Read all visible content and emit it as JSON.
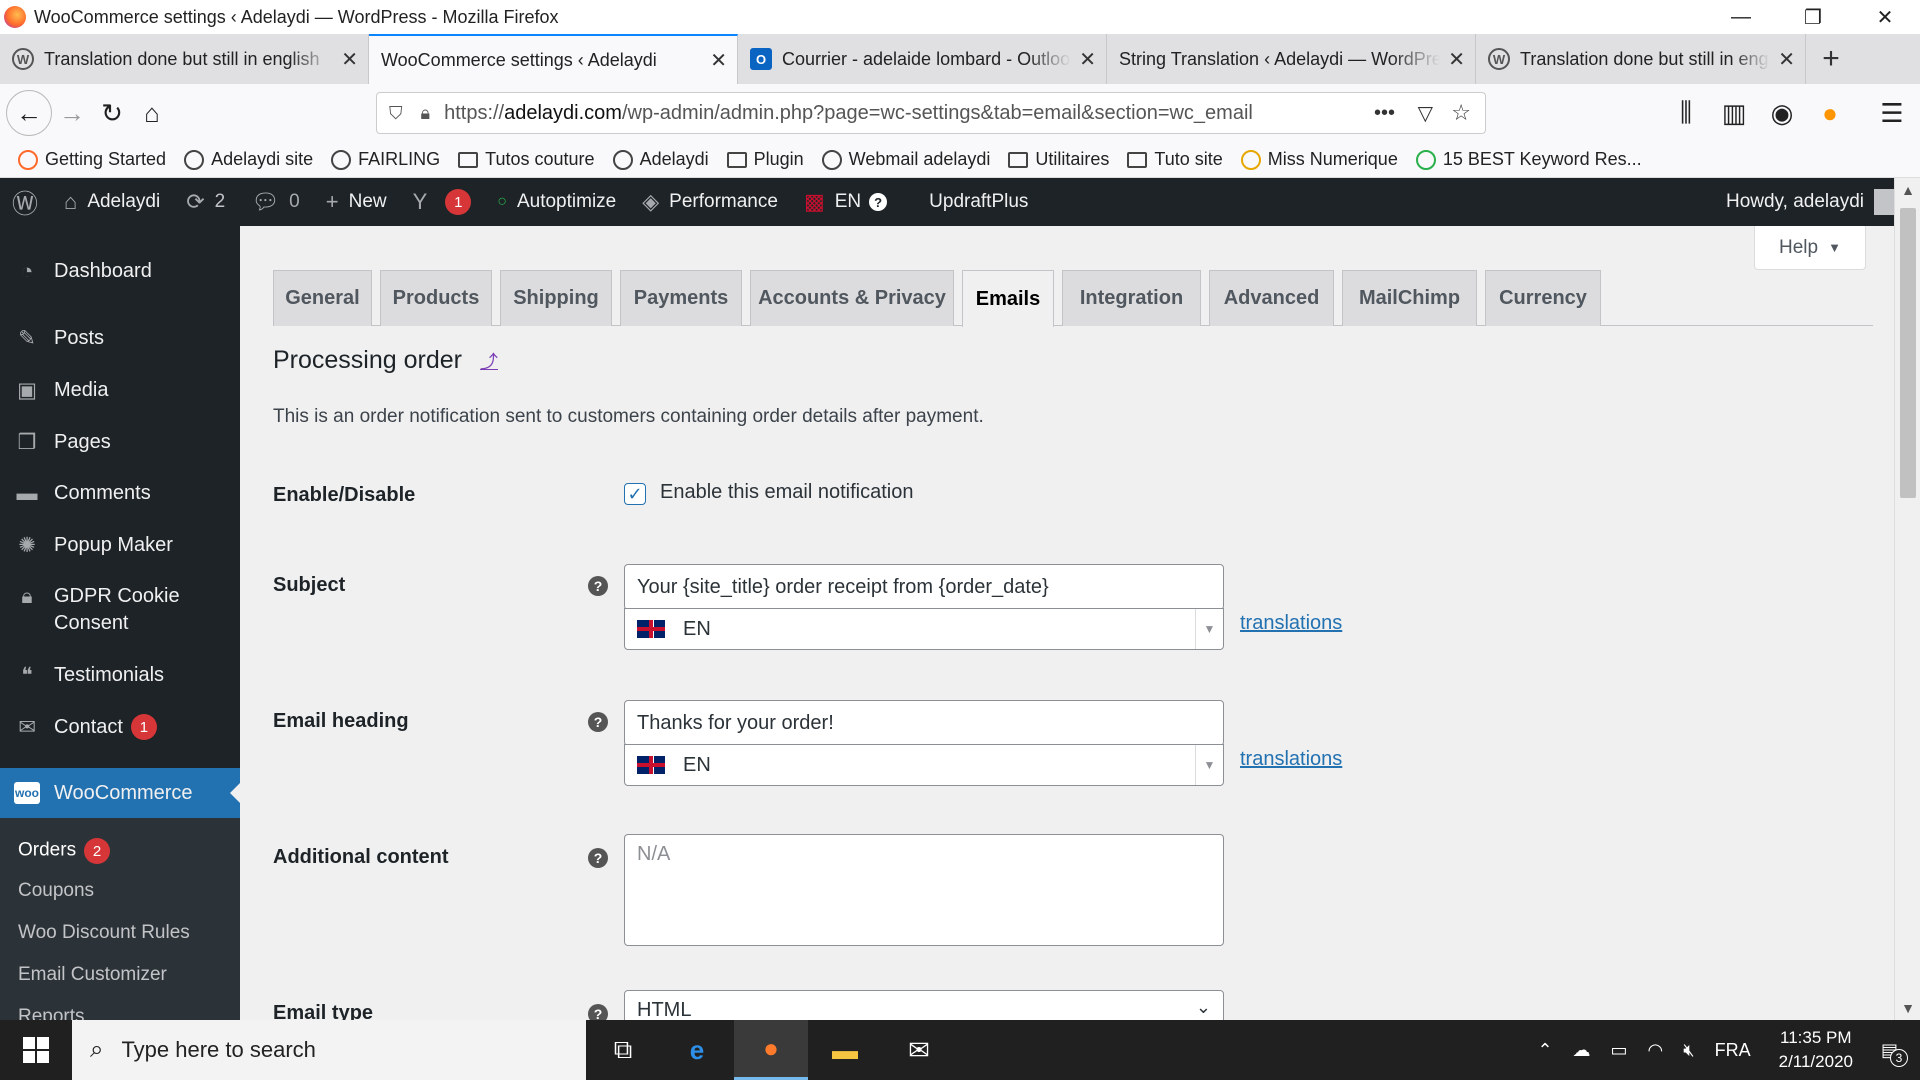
{
  "window": {
    "title": "WooCommerce settings ‹ Adelaydi — WordPress - Mozilla Firefox"
  },
  "browser_tabs": [
    {
      "label": "Translation done but still in english",
      "icon": "wordpress-icon",
      "active": false
    },
    {
      "label": "WooCommerce settings ‹ Adelaydi",
      "icon": "wordpress-icon",
      "active": true
    },
    {
      "label": "Courrier - adelaide lombard - Outlook",
      "icon": "outlook-icon",
      "active": false
    },
    {
      "label": "String Translation ‹ Adelaydi — WordPress",
      "icon": "none",
      "active": false
    },
    {
      "label": "Translation done but still in english",
      "icon": "wordpress-icon",
      "active": false
    }
  ],
  "address": {
    "prefix": "https://",
    "domain": "adelaydi.com",
    "path": "/wp-admin/admin.php?page=wc-settings&tab=email&section=wc_email"
  },
  "bookmarks": [
    {
      "label": "Getting Started",
      "icon": "firefox-icon"
    },
    {
      "label": "Adelaydi site",
      "icon": "globe-icon"
    },
    {
      "label": "FAIRLING",
      "icon": "link-icon"
    },
    {
      "label": "Tutos couture",
      "icon": "folder-icon"
    },
    {
      "label": "Adelaydi",
      "icon": "globe-icon"
    },
    {
      "label": "Plugin",
      "icon": "folder-icon"
    },
    {
      "label": "Webmail adelaydi",
      "icon": "globe-icon"
    },
    {
      "label": "Utilitaires",
      "icon": "folder-icon"
    },
    {
      "label": "Tuto site",
      "icon": "folder-icon"
    },
    {
      "label": "Miss Numerique",
      "icon": "globe-icon"
    },
    {
      "label": "15 BEST Keyword Res...",
      "icon": "circle-icon"
    }
  ],
  "adminbar": {
    "site": "Adelaydi",
    "updates": "2",
    "comments": "0",
    "new": "New",
    "yoast_count": "1",
    "autoptimize": "Autoptimize",
    "performance": "Performance",
    "lang": "EN",
    "updraft": "UpdraftPlus",
    "howdy": "Howdy, adelaydi"
  },
  "sidebar": {
    "items": [
      "Dashboard",
      "Posts",
      "Media",
      "Pages",
      "Comments",
      "Popup Maker",
      "GDPR Cookie Consent",
      "Testimonials",
      "Contact",
      "WooCommerce"
    ],
    "contact_badge": "1",
    "sub": [
      "Orders",
      "Coupons",
      "Woo Discount Rules",
      "Email Customizer",
      "Reports"
    ],
    "orders_badge": "2"
  },
  "help_label": "Help",
  "wc_tabs": [
    "General",
    "Products",
    "Shipping",
    "Payments",
    "Accounts & Privacy",
    "Emails",
    "Integration",
    "Advanced",
    "MailChimp",
    "Currency"
  ],
  "page": {
    "title": "Processing order",
    "up_link": "⤴",
    "description": "This is an order notification sent to customers containing order details after payment."
  },
  "fields": {
    "enable_label": "Enable/Disable",
    "enable_checkbox_label": "Enable this email notification",
    "subject_label": "Subject",
    "subject_value": "Your {site_title} order receipt from {order_date}",
    "subject_lang": "EN",
    "heading_label": "Email heading",
    "heading_value": "Thanks for your order!",
    "heading_lang": "EN",
    "translations_link": "translations",
    "additional_label": "Additional content",
    "additional_placeholder": "N/A",
    "email_type_label": "Email type",
    "email_type_value": "HTML"
  },
  "taskbar": {
    "search_placeholder": "Type here to search",
    "lang": "FRA",
    "time": "11:35 PM",
    "date": "2/11/2020",
    "notifications": "3"
  },
  "colors": {
    "admin_dark": "#1d2327",
    "accent": "#2271b1",
    "badge": "#d63638"
  }
}
